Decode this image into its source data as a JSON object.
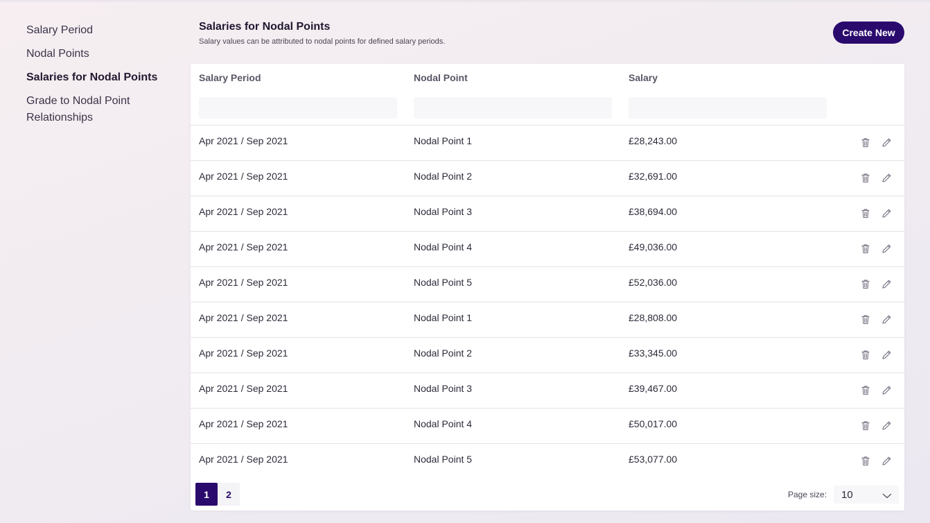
{
  "sidebar": {
    "items": [
      {
        "label": "Salary Period"
      },
      {
        "label": "Nodal Points"
      },
      {
        "label": "Salaries for Nodal Points"
      },
      {
        "label": "Grade to Nodal Point Relationships"
      }
    ]
  },
  "header": {
    "title": "Salaries for Nodal Points",
    "subtitle": "Salary values can be attributed to nodal points for defined salary periods.",
    "create_label": "Create New"
  },
  "table": {
    "columns": [
      "Salary Period",
      "Nodal Point",
      "Salary"
    ],
    "rows": [
      {
        "period": "Apr 2021 / Sep 2021",
        "nodal_point": "Nodal Point 1",
        "salary": "£28,243.00"
      },
      {
        "period": "Apr 2021 / Sep 2021",
        "nodal_point": "Nodal Point 2",
        "salary": "£32,691.00"
      },
      {
        "period": "Apr 2021 / Sep 2021",
        "nodal_point": "Nodal Point 3",
        "salary": "£38,694.00"
      },
      {
        "period": "Apr 2021 / Sep 2021",
        "nodal_point": "Nodal Point 4",
        "salary": "£49,036.00"
      },
      {
        "period": "Apr 2021 / Sep 2021",
        "nodal_point": "Nodal Point 5",
        "salary": "£52,036.00"
      },
      {
        "period": "Apr 2021 / Sep 2021",
        "nodal_point": "Nodal Point 1",
        "salary": "£28,808.00"
      },
      {
        "period": "Apr 2021 / Sep 2021",
        "nodal_point": "Nodal Point 2",
        "salary": "£33,345.00"
      },
      {
        "period": "Apr 2021 / Sep 2021",
        "nodal_point": "Nodal Point 3",
        "salary": "£39,467.00"
      },
      {
        "period": "Apr 2021 / Sep 2021",
        "nodal_point": "Nodal Point 4",
        "salary": "£50,017.00"
      },
      {
        "period": "Apr 2021 / Sep 2021",
        "nodal_point": "Nodal Point 5",
        "salary": "£53,077.00"
      }
    ],
    "row_action_icons": [
      "trash-icon",
      "pencil-icon"
    ]
  },
  "pagination": {
    "pages": [
      "1",
      "2"
    ],
    "current_page": "1",
    "page_size_label": "Page size:",
    "page_size": "10"
  },
  "colors": {
    "accent": "#2b0a6e",
    "background": "#f3eef2",
    "card": "#ffffff",
    "divider": "#e4e2e8"
  }
}
